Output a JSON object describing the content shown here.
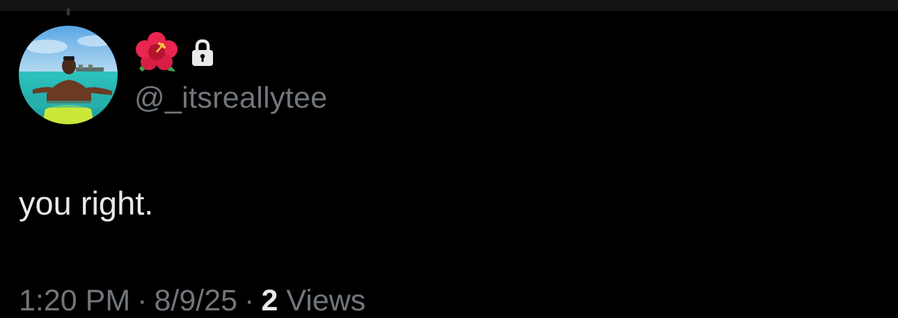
{
  "profile": {
    "display_name_icon": "hibiscus-emoji",
    "protected_icon": "lock-icon",
    "handle": "@_itsreallytee",
    "avatar_icon": "avatar-photo"
  },
  "tweet": {
    "text": "you right."
  },
  "meta": {
    "time": "1:20 PM",
    "separator": "·",
    "date": "8/9/25",
    "views_count": "2",
    "views_label": "Views"
  },
  "colors": {
    "background": "#000000",
    "text_primary": "#e7e9ea",
    "text_secondary": "#71767b"
  }
}
